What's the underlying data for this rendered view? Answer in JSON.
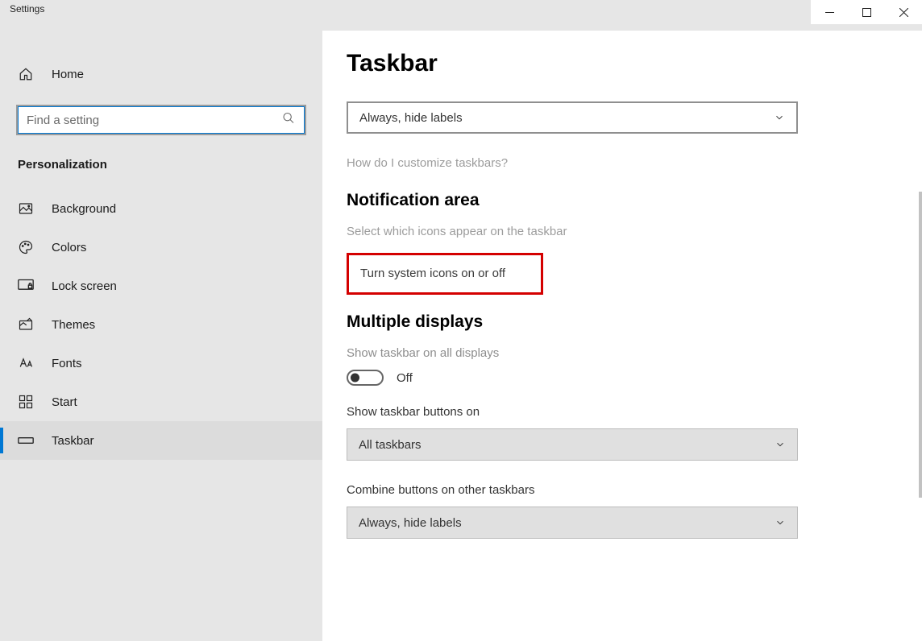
{
  "window": {
    "title": "Settings"
  },
  "sidebar": {
    "home": "Home",
    "search_placeholder": "Find a setting",
    "section": "Personalization",
    "items": [
      {
        "label": "Background"
      },
      {
        "label": "Colors"
      },
      {
        "label": "Lock screen"
      },
      {
        "label": "Themes"
      },
      {
        "label": "Fonts"
      },
      {
        "label": "Start"
      },
      {
        "label": "Taskbar"
      }
    ]
  },
  "content": {
    "title": "Taskbar",
    "dropdown1": "Always, hide labels",
    "help_link": "How do I customize taskbars?",
    "notification_area": {
      "heading": "Notification area",
      "link1": "Select which icons appear on the taskbar",
      "link2": "Turn system icons on or off"
    },
    "multiple_displays": {
      "heading": "Multiple displays",
      "show_all_label": "Show taskbar on all displays",
      "toggle_state": "Off",
      "show_buttons_label": "Show taskbar buttons on",
      "show_buttons_value": "All taskbars",
      "combine_label": "Combine buttons on other taskbars",
      "combine_value": "Always, hide labels"
    }
  }
}
